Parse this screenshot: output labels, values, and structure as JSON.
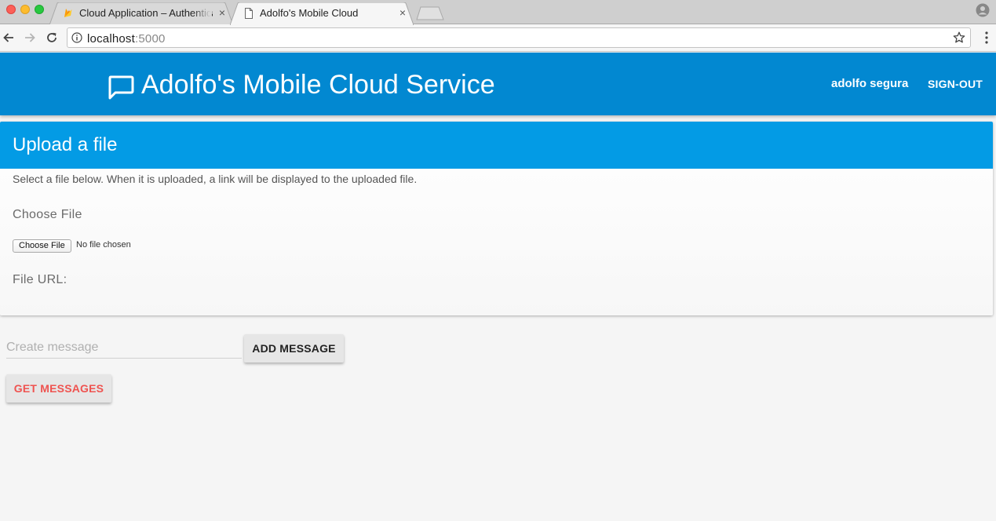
{
  "browser": {
    "tabs": [
      {
        "title": "Cloud Application – Authentica",
        "icon": "firebase-icon",
        "close": "×"
      },
      {
        "title": "Adolfo's Mobile Cloud",
        "icon": "document-icon",
        "close": "×"
      }
    ],
    "url_host": "localhost",
    "url_port": ":5000"
  },
  "header": {
    "title": "Adolfo's Mobile Cloud Service",
    "user": "adolfo segura",
    "signout": "SIGN-OUT",
    "icon": "chat-icon",
    "color": "#0288d1"
  },
  "upload_card": {
    "title": "Upload a file",
    "description": "Select a file below. When it is uploaded, a link will be displayed to the uploaded file.",
    "choose_label": "Choose File",
    "file_button": "Choose File",
    "file_status": "No file chosen",
    "url_label": "File URL:",
    "color": "#039be5"
  },
  "messages": {
    "input_placeholder": "Create message",
    "input_value": "",
    "add_button": "ADD MESSAGE",
    "get_button": "GET MESSAGES",
    "get_button_color": "#ef5350"
  }
}
